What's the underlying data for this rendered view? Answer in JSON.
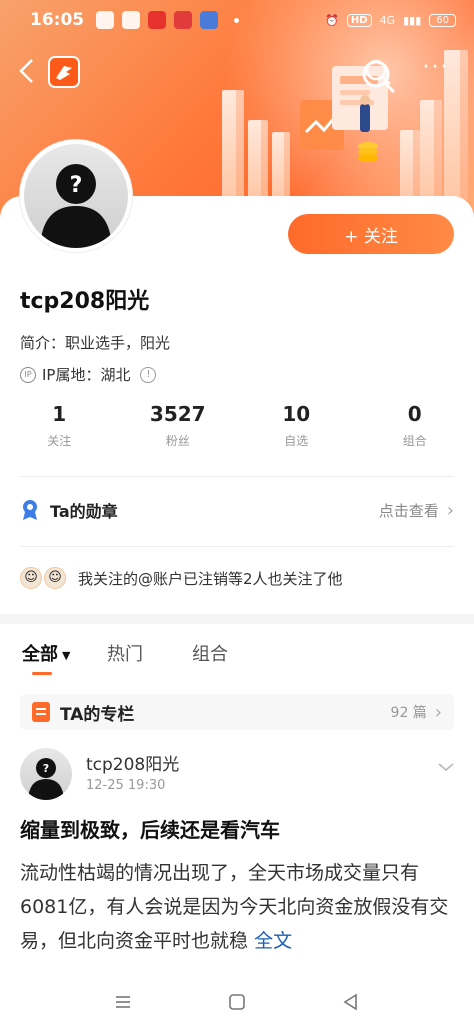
{
  "status_bar": {
    "time": "16:05",
    "network": "4G",
    "hd": "HD",
    "battery": "60"
  },
  "nav": {
    "back_icon": "chevron-left-icon",
    "logo_icon": "app-logo-icon",
    "search_icon": "search-icon",
    "more_icon": "more-dots-icon"
  },
  "profile": {
    "follow_label": "+ 关注",
    "username": "tcp208阳光",
    "intro": "简介：职业选手，阳光",
    "ip_label": "IP属地：湖北"
  },
  "stats": [
    {
      "value": "1",
      "label": "关注"
    },
    {
      "value": "3527",
      "label": "粉丝"
    },
    {
      "value": "10",
      "label": "自选"
    },
    {
      "value": "0",
      "label": "组合"
    }
  ],
  "medal": {
    "title": "Ta的勋章",
    "link": "点击查看"
  },
  "mutual": {
    "text": "我关注的@账户已注销等2人也关注了他"
  },
  "tabs": [
    {
      "label": "全部"
    },
    {
      "label": "热门"
    },
    {
      "label": "组合"
    }
  ],
  "column": {
    "title": "TA的专栏",
    "count": "92 篇"
  },
  "post": {
    "author": "tcp208阳光",
    "time": "12-25 19:30",
    "title": "缩量到极致，后续还是看汽车",
    "body": "流动性枯竭的情况出现了，全天市场成交量只有6081亿，有人会说是因为今天北向资金放假没有交易，但北向资金平时也就稳",
    "fulltext": "全文"
  },
  "colors": {
    "accent": "#ff6a2a",
    "link": "#1a5fb4"
  }
}
